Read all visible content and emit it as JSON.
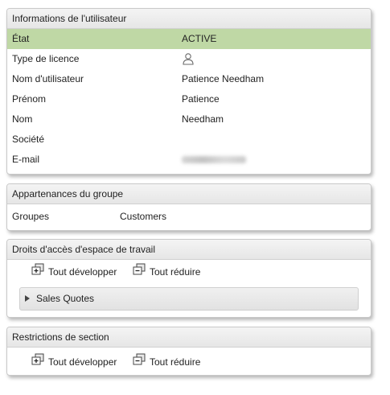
{
  "user_info": {
    "title": "Informations de l'utilisateur",
    "rows": [
      {
        "label": "État",
        "value": "ACTIVE"
      },
      {
        "label": "Type de licence",
        "value": "",
        "icon": "user-icon"
      },
      {
        "label": "Nom d'utilisateur",
        "value": "Patience Needham"
      },
      {
        "label": "Prénom",
        "value": "Patience"
      },
      {
        "label": "Nom",
        "value": "Needham"
      },
      {
        "label": "Société",
        "value": ""
      },
      {
        "label": "E-mail",
        "value": ""
      }
    ],
    "active_color": "#bfd8a5"
  },
  "group": {
    "title": "Appartenances du groupe",
    "label": "Groupes",
    "value": "Customers"
  },
  "workspace": {
    "title": "Droits d'accès d'espace de travail",
    "expand_label": "Tout développer",
    "collapse_label": "Tout réduire",
    "items": [
      {
        "label": "Sales Quotes"
      }
    ]
  },
  "sections": {
    "title": "Restrictions de section",
    "expand_label": "Tout développer",
    "collapse_label": "Tout réduire"
  }
}
